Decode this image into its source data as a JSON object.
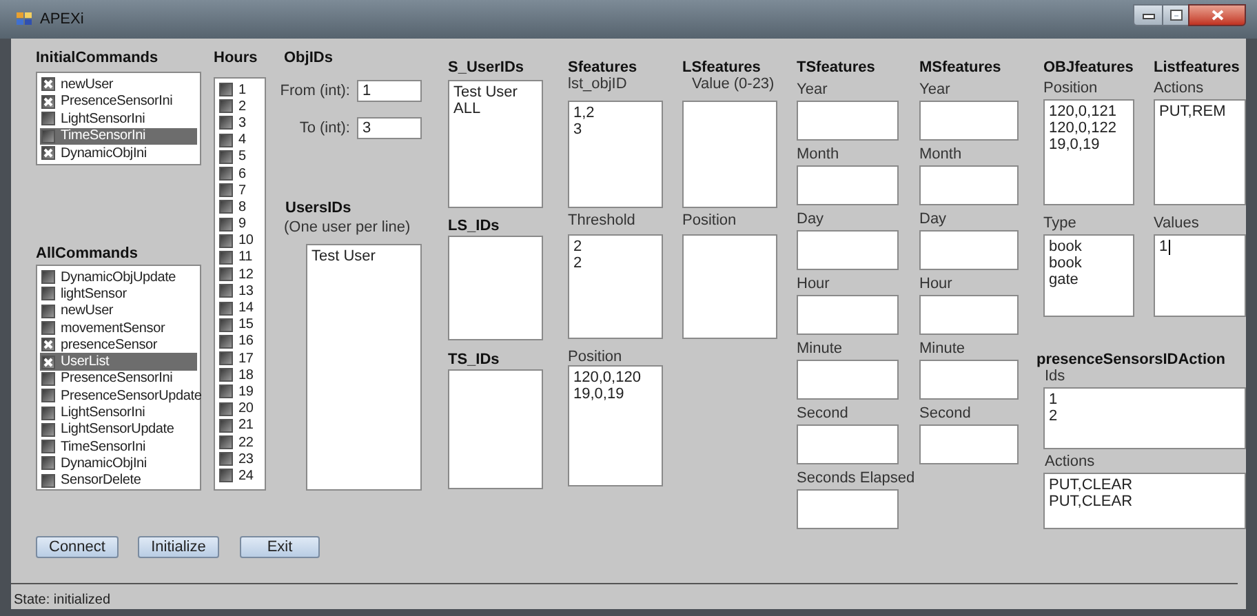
{
  "window": {
    "title": "APEXi"
  },
  "initial_commands": {
    "title": "InitialCommands",
    "items": [
      {
        "label": "newUser",
        "checked": true,
        "selected": false
      },
      {
        "label": "PresenceSensorIni",
        "checked": true,
        "selected": false
      },
      {
        "label": "LightSensorIni",
        "checked": false,
        "selected": false
      },
      {
        "label": "TimeSensorIni",
        "checked": false,
        "selected": true
      },
      {
        "label": "DynamicObjIni",
        "checked": true,
        "selected": false
      }
    ]
  },
  "all_commands": {
    "title": "AllCommands",
    "items": [
      {
        "label": "DynamicObjUpdate",
        "checked": false,
        "selected": false
      },
      {
        "label": "lightSensor",
        "checked": false,
        "selected": false
      },
      {
        "label": "newUser",
        "checked": false,
        "selected": false
      },
      {
        "label": "movementSensor",
        "checked": false,
        "selected": false
      },
      {
        "label": "presenceSensor",
        "checked": true,
        "selected": false
      },
      {
        "label": "UserList",
        "checked": true,
        "selected": true
      },
      {
        "label": "PresenceSensorIni",
        "checked": false,
        "selected": false
      },
      {
        "label": "PresenceSensorUpdate",
        "checked": false,
        "selected": false
      },
      {
        "label": "LightSensorIni",
        "checked": false,
        "selected": false
      },
      {
        "label": "LightSensorUpdate",
        "checked": false,
        "selected": false
      },
      {
        "label": "TimeSensorIni",
        "checked": false,
        "selected": false
      },
      {
        "label": "DynamicObjIni",
        "checked": false,
        "selected": false
      },
      {
        "label": "SensorDelete",
        "checked": false,
        "selected": false
      }
    ]
  },
  "hours": {
    "title": "Hours",
    "items": [
      {
        "label": "1",
        "checked": false
      },
      {
        "label": "2",
        "checked": false
      },
      {
        "label": "3",
        "checked": false
      },
      {
        "label": "4",
        "checked": false
      },
      {
        "label": "5",
        "checked": false
      },
      {
        "label": "6",
        "checked": false
      },
      {
        "label": "7",
        "checked": false
      },
      {
        "label": "8",
        "checked": false
      },
      {
        "label": "9",
        "checked": false
      },
      {
        "label": "10",
        "checked": false
      },
      {
        "label": "11",
        "checked": false
      },
      {
        "label": "12",
        "checked": false
      },
      {
        "label": "13",
        "checked": false
      },
      {
        "label": "14",
        "checked": false
      },
      {
        "label": "15",
        "checked": false
      },
      {
        "label": "16",
        "checked": false
      },
      {
        "label": "17",
        "checked": false
      },
      {
        "label": "18",
        "checked": false
      },
      {
        "label": "19",
        "checked": false
      },
      {
        "label": "20",
        "checked": false
      },
      {
        "label": "21",
        "checked": false
      },
      {
        "label": "22",
        "checked": false
      },
      {
        "label": "23",
        "checked": false
      },
      {
        "label": "24",
        "checked": false
      }
    ]
  },
  "obj_ids": {
    "title": "ObjIDs",
    "from": {
      "label": "From (int):",
      "value": "1"
    },
    "to": {
      "label": "To (int):",
      "value": "3"
    }
  },
  "users_ids": {
    "title": "UsersIDs",
    "hint": "(One user per line)",
    "lines": [
      "Test User"
    ]
  },
  "s_user_ids": {
    "title": "S_UserIDs",
    "lines": [
      "Test User",
      "ALL"
    ]
  },
  "ls_ids": {
    "title": "LS_IDs"
  },
  "ts_ids": {
    "title": "TS_IDs"
  },
  "sfeatures": {
    "title": "Sfeatures",
    "fields": [
      {
        "label": "lst_objID",
        "lines": [
          "1,2",
          "3"
        ]
      },
      {
        "label": "Threshold",
        "lines": [
          "2",
          "2"
        ]
      },
      {
        "label": "Position",
        "lines": [
          "120,0,120",
          "19,0,19"
        ]
      }
    ]
  },
  "lsfeatures": {
    "title": "LSfeatures",
    "fields": [
      {
        "label": "Value (0-23)"
      },
      {
        "label": "Position"
      }
    ]
  },
  "tsfeatures": {
    "title": "TSfeatures",
    "fields": [
      {
        "label": "Year"
      },
      {
        "label": "Month"
      },
      {
        "label": "Day"
      },
      {
        "label": "Hour"
      },
      {
        "label": "Minute"
      },
      {
        "label": "Second"
      },
      {
        "label": "Seconds Elapsed"
      }
    ]
  },
  "msfeatures": {
    "title": "MSfeatures",
    "fields": [
      {
        "label": "Year"
      },
      {
        "label": "Month"
      },
      {
        "label": "Day"
      },
      {
        "label": "Hour"
      },
      {
        "label": "Minute"
      },
      {
        "label": "Second"
      }
    ]
  },
  "objfeatures": {
    "title": "OBJfeatures",
    "fields": [
      {
        "label": "Position",
        "lines": [
          "120,0,121",
          "120,0,122",
          "19,0,19"
        ]
      },
      {
        "label": "Type",
        "lines": [
          "book",
          "book",
          "gate"
        ]
      }
    ]
  },
  "listfeatures": {
    "title": "Listfeatures",
    "fields": [
      {
        "label": "Actions",
        "lines": [
          "PUT,REM"
        ]
      },
      {
        "label": "Values",
        "lines": [
          "1"
        ],
        "focused": true
      }
    ]
  },
  "presence_sensors_id_action": {
    "title": "presenceSensorsIDAction",
    "fields": [
      {
        "label": "Ids",
        "lines": [
          "1",
          "2"
        ]
      },
      {
        "label": "Actions",
        "lines": [
          "PUT,CLEAR",
          "PUT,CLEAR"
        ]
      }
    ]
  },
  "buttons": [
    "Connect",
    "Initialize",
    "Exit"
  ],
  "status_bar": "State: initialized"
}
